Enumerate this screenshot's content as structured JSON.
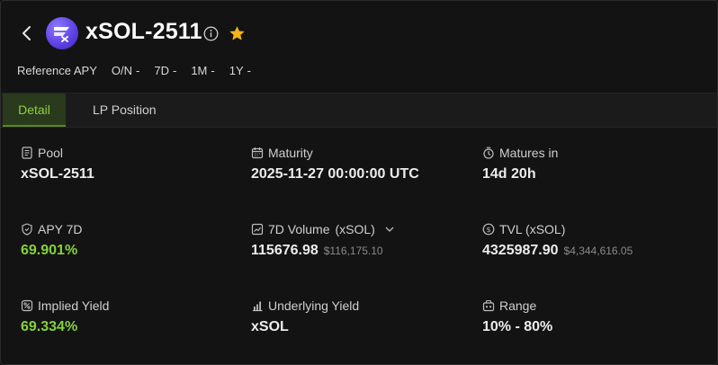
{
  "header": {
    "title": "xSOL-2511",
    "apy_label": "Reference APY",
    "apy_periods": [
      {
        "label": "O/N",
        "value": "-"
      },
      {
        "label": "7D",
        "value": "-"
      },
      {
        "label": "1M",
        "value": "-"
      },
      {
        "label": "1Y",
        "value": "-"
      }
    ]
  },
  "tabs": [
    {
      "label": "Detail",
      "active": true
    },
    {
      "label": "LP Position",
      "active": false
    }
  ],
  "stats": {
    "pool": {
      "label": "Pool",
      "value": "xSOL-2511"
    },
    "maturity": {
      "label": "Maturity",
      "value": "2025-11-27 00:00:00 UTC"
    },
    "matures_in": {
      "label": "Matures in",
      "value": "14d 20h"
    },
    "apy_7d": {
      "label": "APY 7D",
      "value": "69.901%"
    },
    "volume_7d": {
      "label": "7D Volume",
      "unit": "(xSOL)",
      "value": "115676.98",
      "usd": "$116,175.10"
    },
    "tvl": {
      "label": "TVL (xSOL)",
      "value": "4325987.90",
      "usd": "$4,344,616.05"
    },
    "implied_yield": {
      "label": "Implied Yield",
      "value": "69.334%"
    },
    "underlying_yield": {
      "label": "Underlying Yield",
      "value": "xSOL"
    },
    "range": {
      "label": "Range",
      "value": "10% - 80%"
    }
  },
  "colors": {
    "accent_green": "#86d13a",
    "star": "#f2b418",
    "logo": "#6a4cf0"
  }
}
